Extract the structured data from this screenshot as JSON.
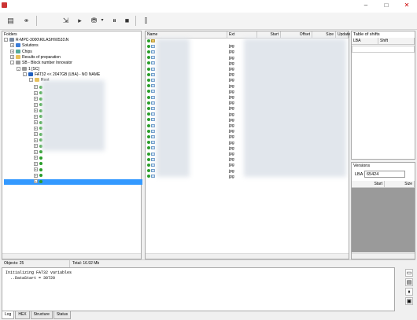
{
  "toolbar": {
    "tools": [
      "save-icon",
      "binoculars-icon",
      "exit-icon",
      "play-icon",
      "drive-icon",
      "pause-icon",
      "stop-icon",
      "tune-icon"
    ]
  },
  "folders": {
    "header": "Folders",
    "items": [
      {
        "label": "R-MPC-3000\\KILASHI\\0531\\N",
        "indent": 0,
        "expander": "-",
        "icon": "computer"
      },
      {
        "label": "Solutions",
        "indent": 1,
        "expander": "+",
        "icon": "blue"
      },
      {
        "label": "Chips",
        "indent": 1,
        "expander": "+",
        "icon": "chip"
      },
      {
        "label": "Results of preparation",
        "indent": 1,
        "expander": "+",
        "icon": "folder"
      },
      {
        "label": "SB - Block number Innovator",
        "indent": 1,
        "expander": "-",
        "icon": "disk"
      },
      {
        "label": "1 [SC]",
        "indent": 2,
        "expander": "-",
        "icon": "disk"
      },
      {
        "label": "FAT32 << 2047GB (LBA) - NO NAME",
        "indent": 3,
        "expander": "-",
        "icon": "info"
      },
      {
        "label": "Root",
        "indent": 4,
        "expander": "-",
        "icon": "folder"
      }
    ],
    "objects": "Objects: 25",
    "total": "Total: 16.92 Mb"
  },
  "files": {
    "columns": [
      "Name",
      "Ext",
      "Start",
      "Offset",
      "Size",
      "Update"
    ],
    "exts": [
      "",
      "jpg",
      "jpg",
      "jpg",
      "jpg",
      "jpg",
      "jpg",
      "jpg",
      "jpg",
      "jpg",
      "jpg",
      "jpg",
      "jpg",
      "jpg",
      "jpg",
      "jpg",
      "jpg",
      "jpg",
      "jpg",
      "jpg",
      "jpg",
      "jpg",
      "jpg",
      "jpg",
      "jpg"
    ]
  },
  "shifts": {
    "header": "Table of shifts",
    "columns": [
      "LBA",
      "Shift"
    ]
  },
  "versions": {
    "header": "Versions",
    "lba_label": "LBA",
    "lba_value": "65424",
    "columns": [
      "Start",
      "Size"
    ]
  },
  "log": {
    "lines": [
      "Initializing FAT32 variables",
      "  ..DataStart = 30720"
    ],
    "tabs": [
      "Log",
      "HEX",
      "Structure",
      "Status"
    ]
  }
}
